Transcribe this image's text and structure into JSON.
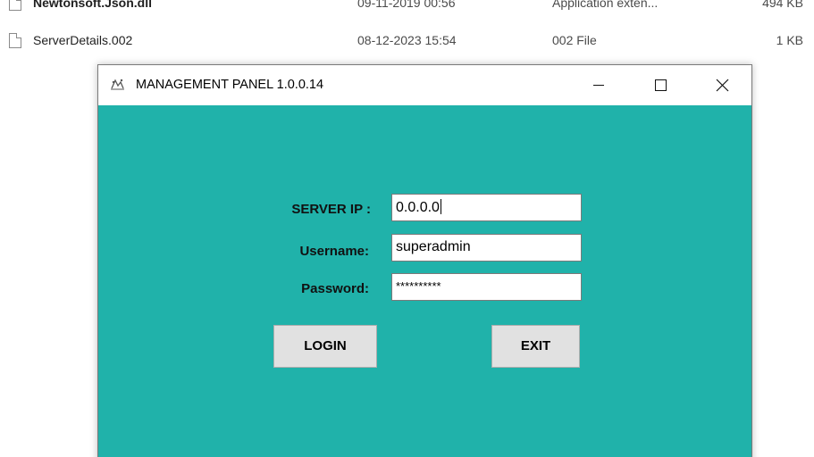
{
  "explorer": {
    "files": [
      {
        "name": "Newtonsoft.Json.dll",
        "date": "09-11-2019 00:56",
        "type": "Application exten...",
        "size": "494 KB"
      },
      {
        "name": "ServerDetails.002",
        "date": "08-12-2023 15:54",
        "type": "002 File",
        "size": "1 KB"
      }
    ]
  },
  "window": {
    "title": "MANAGEMENT PANEL 1.0.0.14",
    "app_icon": "app-logo-icon",
    "controls": [
      "minimize",
      "maximize",
      "close"
    ],
    "background_color": "#20b2aa"
  },
  "form": {
    "server_ip_label": "SERVER IP :",
    "server_ip_value": "0.0.0.0",
    "username_label": "Username:",
    "username_value": "superadmin",
    "password_label": "Password:",
    "password_value": "**********",
    "login_label": "LOGIN",
    "exit_label": "EXIT"
  }
}
